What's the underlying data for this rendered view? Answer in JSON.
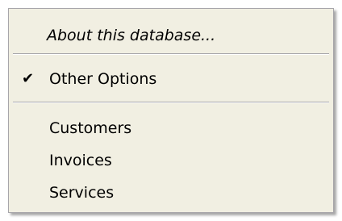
{
  "menu": {
    "items": [
      {
        "label": "About this database...",
        "checked": false,
        "italic": true
      },
      {
        "label": "Other Options",
        "checked": true,
        "italic": false
      },
      {
        "label": "Customers",
        "checked": false,
        "italic": false
      },
      {
        "label": "Invoices",
        "checked": false,
        "italic": false
      },
      {
        "label": "Services",
        "checked": false,
        "italic": false
      }
    ],
    "check_glyph": "✔"
  },
  "colors": {
    "menu_background": "#f1efe2",
    "border": "#a7a6aa",
    "text": "#000000"
  }
}
